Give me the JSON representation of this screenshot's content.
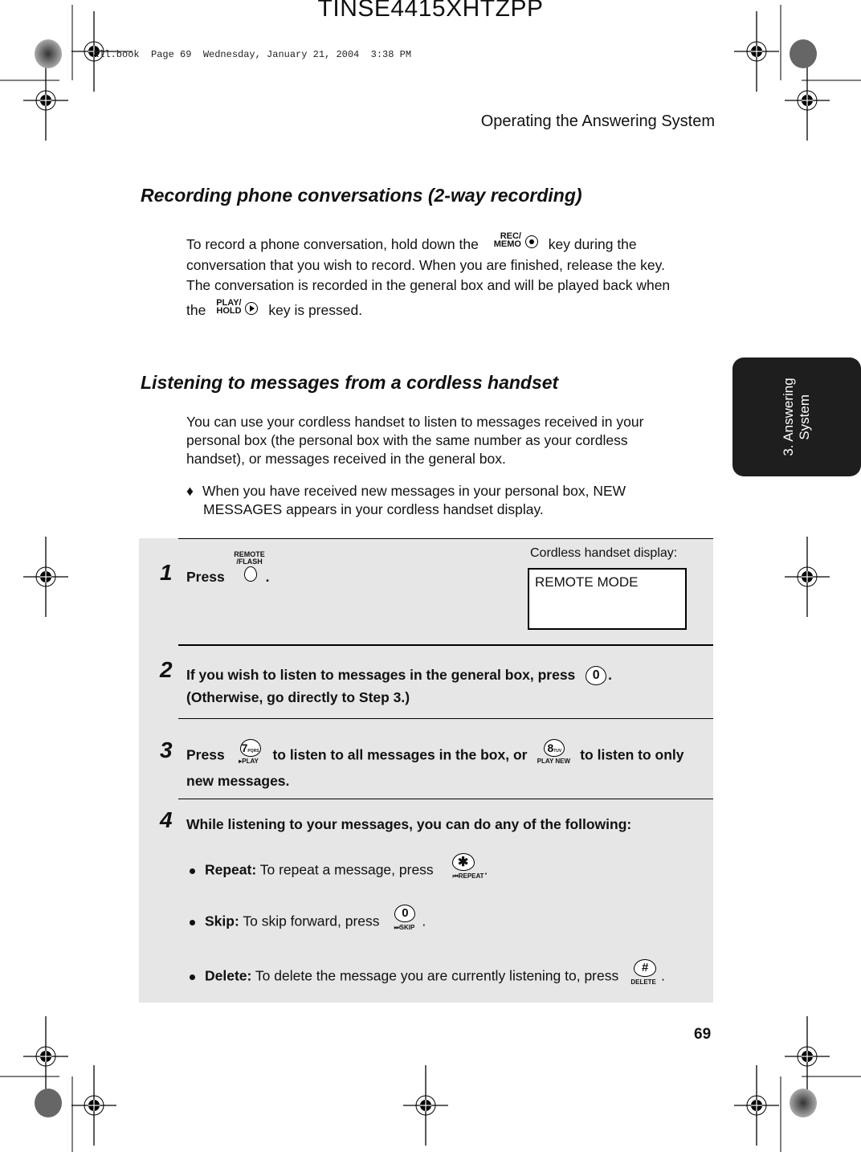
{
  "header": {
    "doc_code": "TINSE4415XHTZPP",
    "file_stamp": "all.book  Page 69  Wednesday, January 21, 2004  3:38 PM",
    "running_head": "Operating the Answering System"
  },
  "side_tab": {
    "line1": "3. Answering",
    "line2": "System"
  },
  "section1": {
    "title": "Recording phone conversations (2-way recording)",
    "p1_a": "To record a phone conversation, hold down the",
    "p1_b": "key during the",
    "p1_line2": "conversation that you wish to record. When you are finished, release the key.",
    "p1_line3": "The conversation is recorded in the general box and  will be played back when",
    "p1_line4_a": "the",
    "p1_line4_b": "key is pressed.",
    "key_rec": {
      "top": "REC/",
      "bottom": "MEMO",
      "icon": "record-icon"
    },
    "key_play": {
      "top": "PLAY/",
      "bottom": "HOLD",
      "icon": "play-icon"
    }
  },
  "section2": {
    "title": "Listening to messages from a cordless handset",
    "p_line1": "You can use your cordless handset to listen to messages received in your",
    "p_line2": "personal box (the personal box with the same number as your cordless",
    "p_line3": "handset), or messages received in the general box.",
    "bullet_symbol": "♦",
    "bullet_line1": "When you have received new messages in your personal box, NEW",
    "bullet_line2": "MESSAGES appears in your cordless handset display."
  },
  "steps": [
    {
      "num": "1",
      "text_a": "Press",
      "text_b": ".",
      "key": {
        "top": "REMOTE",
        "bottom": "/FLASH"
      }
    },
    {
      "num": "2",
      "text_a": "If you wish to listen to messages in the general box, press",
      "text_b": ".",
      "line2": "(Otherwise, go directly to Step 3.)",
      "key": {
        "face": "0"
      }
    },
    {
      "num": "3",
      "text_a": "Press",
      "text_b": "to listen to all messages in the box, or",
      "text_c": "to listen to only",
      "line2": "new messages.",
      "key_a": {
        "face": "7",
        "sub": "PQRS",
        "bottom": "▸PLAY"
      },
      "key_b": {
        "face": "8",
        "sub": "TUV",
        "bottom": "PLAY NEW"
      }
    },
    {
      "num": "4",
      "text": "While listening to your messages, you can do any of the following:"
    }
  ],
  "step4_bullets": [
    {
      "label": "Repeat:",
      "text": "To repeat a message, press",
      "end": ".",
      "key": {
        "face": "✱",
        "bottom": "⏮REPEAT"
      }
    },
    {
      "label": "Skip:",
      "text": "To skip forward, press",
      "end": ".",
      "key": {
        "face": "0",
        "bottom": "⏭SKIP"
      }
    },
    {
      "label": "Delete:",
      "text": "To delete the message you are currently listening to, press",
      "end": ".",
      "key": {
        "face": "#",
        "bottom": "DELETE"
      }
    }
  ],
  "display": {
    "label": "Cordless handset display:",
    "text": "REMOTE MODE"
  },
  "footer": {
    "page_number": "69"
  }
}
